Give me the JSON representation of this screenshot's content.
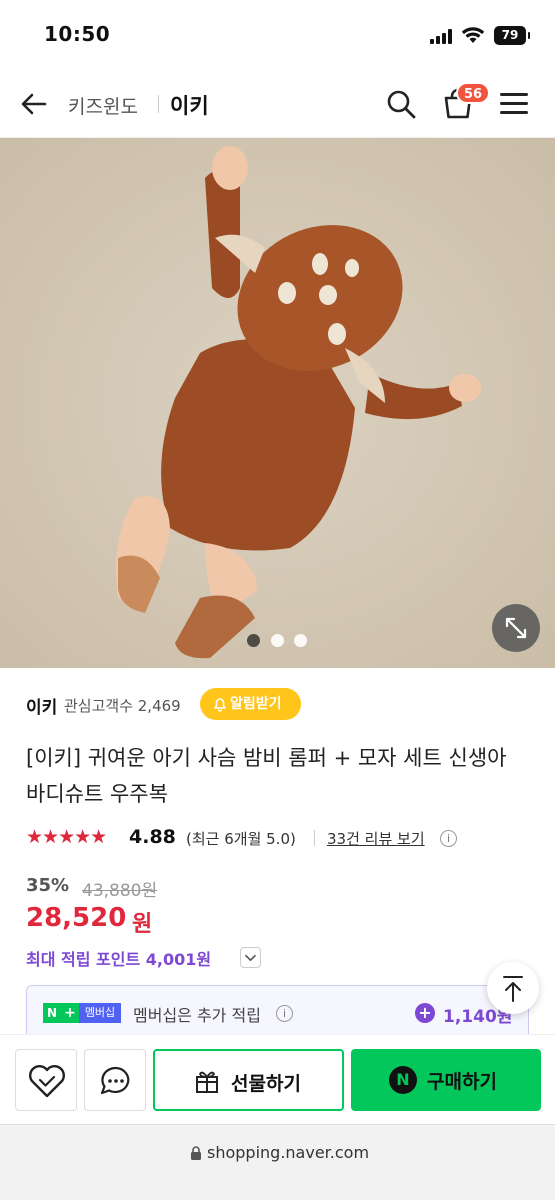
{
  "status_bar": {
    "time": "10:50",
    "battery": "79"
  },
  "header": {
    "breadcrumb": "키즈윈도",
    "store_title": "이키",
    "cart_count": "56"
  },
  "carousel": {
    "slide_count": 3,
    "active_index": 0
  },
  "store": {
    "name": "이키",
    "followers": "관심고객수 2,469",
    "alarm_label": "알림받기"
  },
  "product": {
    "title": "[이키] 귀여운 아기 사슴 밤비 롬퍼 + 모자 세트 신생아 바디슈트 우주복",
    "stars": "★★★★★",
    "rating": "4.88",
    "recent_rating": "(최근 6개월 5.0)",
    "review_link": "33건 리뷰 보기",
    "info_glyph": "i",
    "discount": "35%",
    "original_price": "43,880원",
    "sale_price": "28,520",
    "price_unit": "원",
    "points": "최대 적립 포인트 4,001원"
  },
  "membership": {
    "badge_n": "N",
    "badge_plus": "+",
    "badge_label": "멤버십",
    "text": "멤버십은 추가 적립",
    "plus_glyph": "+",
    "points": "1,140원"
  },
  "bottom_bar": {
    "gift_label": "선물하기",
    "buy_label": "구매하기",
    "buy_logo": "N"
  },
  "browser": {
    "url": "shopping.naver.com"
  },
  "colors": {
    "accent_green": "#03c75a",
    "price_red": "#e0283c",
    "points_purple": "#7d49d4",
    "alarm_yellow": "#ffc51a",
    "badge_red": "#f0533e"
  }
}
